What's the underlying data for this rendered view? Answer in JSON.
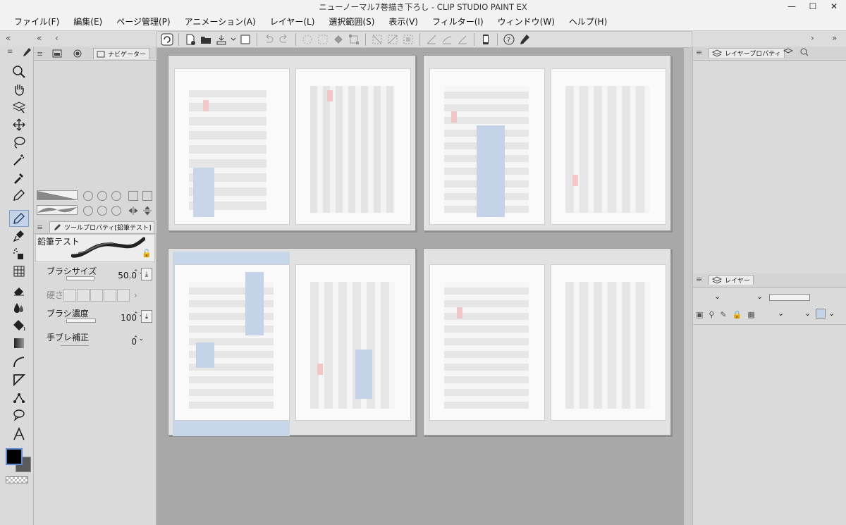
{
  "window": {
    "title": "ニューノーマル7巻描き下ろし - CLIP STUDIO PAINT EX",
    "minimize": "—",
    "maximize": "☐",
    "close": "✕"
  },
  "menu": [
    "ファイル(F)",
    "編集(E)",
    "ページ管理(P)",
    "アニメーション(A)",
    "レイヤー(L)",
    "選択範囲(S)",
    "表示(V)",
    "フィルター(I)",
    "ウィンドウ(W)",
    "ヘルプ(H)"
  ],
  "left_panel": {
    "tabs": {
      "navigator": "ナビゲーター"
    },
    "tool_property": {
      "tab_label": "ツールプロパティ[鉛筆テスト]",
      "tool_name": "鉛筆テスト",
      "brush_size_label": "ブラシサイズ",
      "brush_size_value": "50.0",
      "hardness_label": "硬さ",
      "density_label": "ブラシ濃度",
      "density_value": "100",
      "stabilization_label": "手ブレ補正",
      "stabilization_value": "0"
    }
  },
  "right_panel": {
    "layer_property_tab": "レイヤープロパティ",
    "layer_tab": "レイヤー"
  },
  "colors": {
    "main_color": "#000000",
    "sub_color": "#5a5a5a",
    "accent": "#c4d3e8"
  }
}
